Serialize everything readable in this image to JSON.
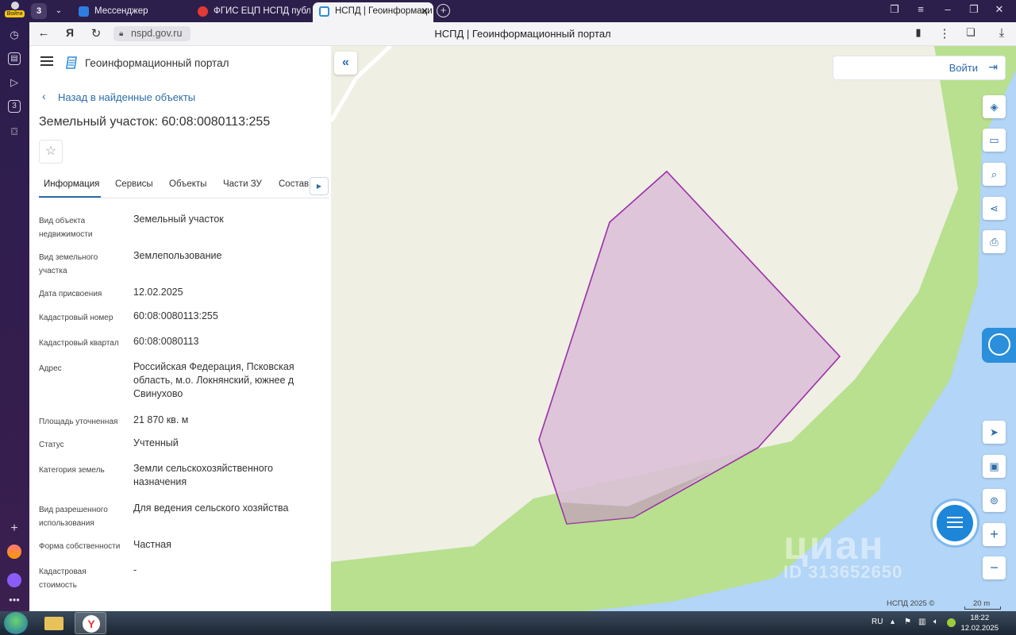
{
  "browser": {
    "sidebar_badge": "Войти",
    "tab_count": "3",
    "tabs": [
      {
        "label": "Мессенджер"
      },
      {
        "label": "ФГИС ЕЦП НСПД публич"
      },
      {
        "label": "НСПД | Геоинформаци"
      }
    ],
    "url": "nspd.gov.ru",
    "page_title": "НСПД | Геоинформационный портал"
  },
  "panel": {
    "portal_name": "Геоинформационный портал",
    "back_link": "Назад в найденные объекты",
    "object_title": "Земельный участок: 60:08:0080113:255",
    "tabs": [
      "Информация",
      "Сервисы",
      "Объекты",
      "Части ЗУ",
      "Состав"
    ],
    "info": [
      {
        "label": "Вид объекта недвижимости",
        "value": "Земельный участок"
      },
      {
        "label": "Вид земельного участка",
        "value": "Землепользование"
      },
      {
        "label": "Дата присвоения",
        "value": "12.02.2025"
      },
      {
        "label": "Кадастровый номер",
        "value": "60:08:0080113:255"
      },
      {
        "label": "Кадастровый квартал",
        "value": "60:08:0080113"
      },
      {
        "label": "Адрес",
        "value": "Российская Федерация, Псковская область, м.о. Локнянский, южнее д Свинухово"
      },
      {
        "label": "Площадь уточненная",
        "value": "21 870 кв. м"
      },
      {
        "label": "Статус",
        "value": "Учтенный"
      },
      {
        "label": "Категория земель",
        "value": "Земли сельскохозяйственного назначения"
      },
      {
        "label": "Вид разрешенного использования",
        "value": "Для ведения сельского хозяйства"
      },
      {
        "label": "Форма собственности",
        "value": "Частная"
      },
      {
        "label": "Кадастровая стоимость",
        "value": "-"
      }
    ]
  },
  "map": {
    "login_label": "Войти",
    "watermark_brand": "циан",
    "watermark_id": "ID 313652650",
    "copyright": "НСПД 2025 ©",
    "scale_label": "20 m",
    "colors": {
      "land": "#efefe4",
      "meadow": "#b8e08f",
      "water": "#b3d5f7",
      "parcel_fill": "#dcc0d8",
      "parcel_border": "#9b2fa6"
    }
  },
  "taskbar": {
    "lang": "RU",
    "time": "18:22",
    "date": "12.02.2025"
  }
}
